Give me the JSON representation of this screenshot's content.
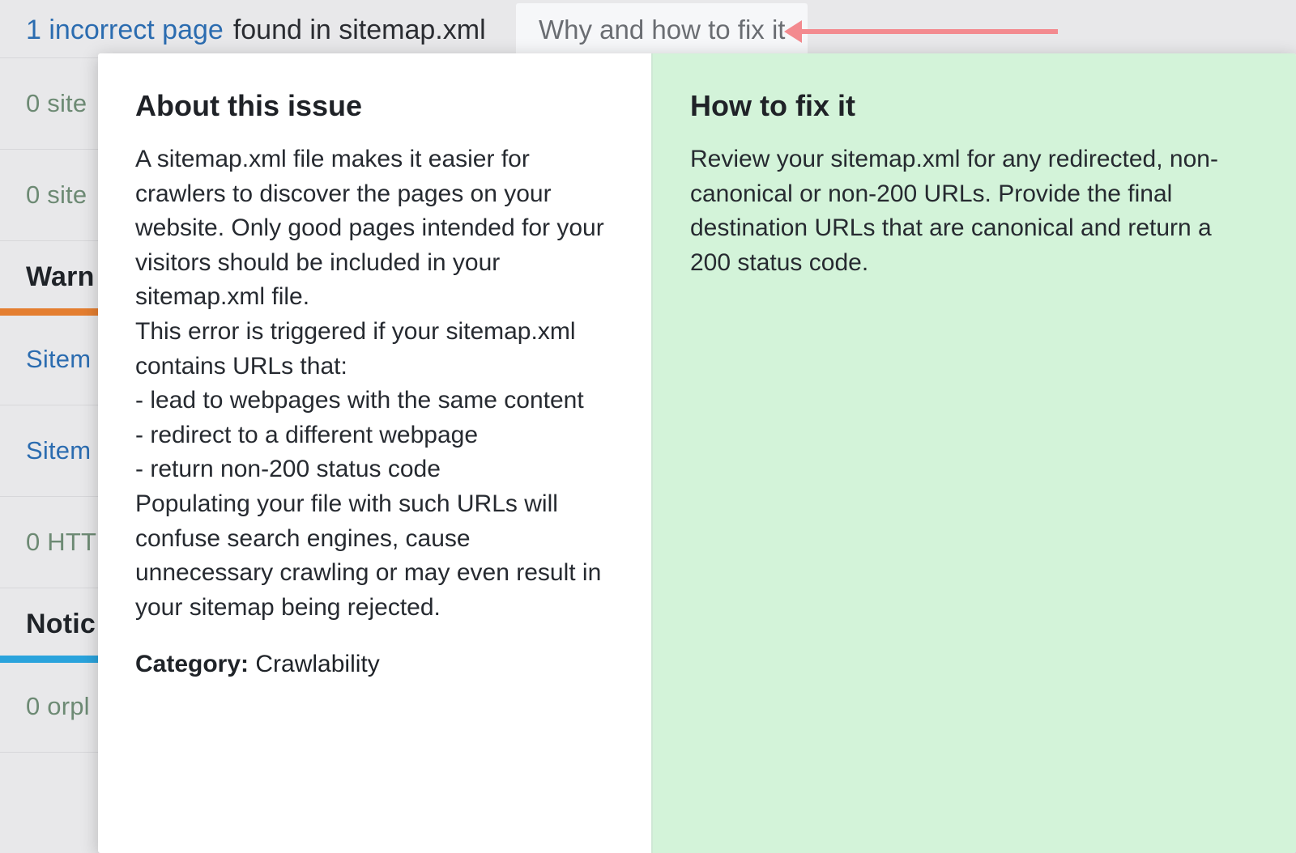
{
  "top_issue": {
    "link_text": "1 incorrect page",
    "rest_text": "found in sitemap.xml"
  },
  "why_chip": "Why and how to fix it",
  "bg_rows": {
    "r1": "0 site",
    "r2": "0 site",
    "warn_header": "Warn",
    "r3": "Sitem",
    "r4": "Sitem",
    "r5": "0 HTT",
    "notic_header": "Notic",
    "r6": "0 orpl"
  },
  "popover": {
    "about": {
      "title": "About this issue",
      "body": "A sitemap.xml file makes it easier for crawlers to discover the pages on your website. Only good pages intended for your visitors should be included in your sitemap.xml file.\nThis error is triggered if your sitemap.xml contains URLs that:\n- lead to webpages with the same content\n- redirect to a different webpage\n- return non-200 status code\nPopulating your file with such URLs will confuse search engines, cause unnecessary crawling or may even result in your sitemap being rejected.",
      "category_label": "Category:",
      "category_value": " Crawlability"
    },
    "fix": {
      "title": "How to fix it",
      "body": "Review your sitemap.xml for any redirected, non-canonical or non-200 URLs. Provide the final destination URLs that are canonical and return a 200 status code."
    }
  }
}
